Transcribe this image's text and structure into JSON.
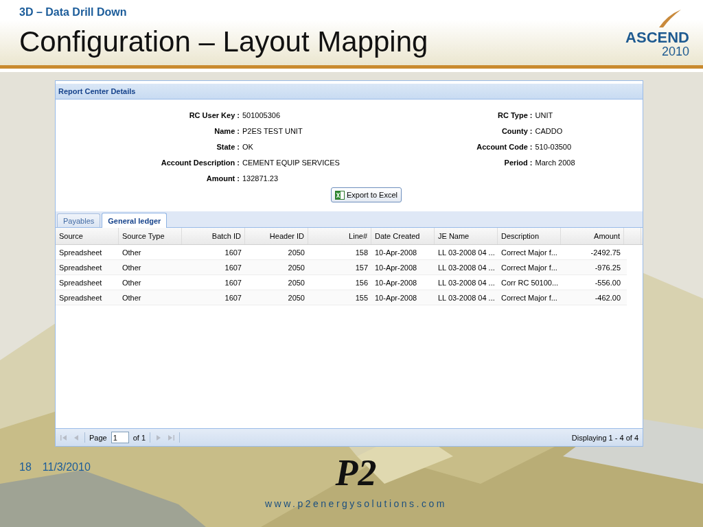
{
  "slide": {
    "section": "3D – Data Drill Down",
    "title": "Configuration – Layout Mapping",
    "logo": {
      "name": "ASCEND",
      "year": "2010"
    }
  },
  "panel": {
    "title": "Report Center Details",
    "fields_left": [
      {
        "label": "RC User Key :",
        "value": "501005306"
      },
      {
        "label": "Name :",
        "value": "P2ES TEST UNIT"
      },
      {
        "label": "State :",
        "value": "OK"
      },
      {
        "label": "Account Description :",
        "value": "CEMENT EQUIP SERVICES"
      },
      {
        "label": "Amount :",
        "value": "132871.23"
      }
    ],
    "fields_right": [
      {
        "label": "RC Type :",
        "value": "UNIT"
      },
      {
        "label": "County :",
        "value": "CADDO"
      },
      {
        "label": "Account Code :",
        "value": "510-03500"
      },
      {
        "label": "Period :",
        "value": "March 2008"
      }
    ],
    "export_button": "Export to Excel",
    "tabs": [
      {
        "label": "Payables",
        "selected": false
      },
      {
        "label": "General ledger",
        "selected": true
      }
    ],
    "table": {
      "columns": [
        {
          "label": "Source",
          "kind": "text"
        },
        {
          "label": "Source Type",
          "kind": "text"
        },
        {
          "label": "Batch ID",
          "kind": "number"
        },
        {
          "label": "Header ID",
          "kind": "number"
        },
        {
          "label": "Line#",
          "kind": "number"
        },
        {
          "label": "Date Created",
          "kind": "text"
        },
        {
          "label": "JE Name",
          "kind": "text"
        },
        {
          "label": "Description",
          "kind": "text"
        },
        {
          "label": "Amount",
          "kind": "number"
        }
      ],
      "rows": [
        [
          "Spreadsheet",
          "Other",
          "1607",
          "2050",
          "158",
          "10-Apr-2008",
          "LL 03-2008 04 ...",
          "Correct Major f...",
          "-2492.75"
        ],
        [
          "Spreadsheet",
          "Other",
          "1607",
          "2050",
          "157",
          "10-Apr-2008",
          "LL 03-2008 04 ...",
          "Correct Major f...",
          "-976.25"
        ],
        [
          "Spreadsheet",
          "Other",
          "1607",
          "2050",
          "156",
          "10-Apr-2008",
          "LL 03-2008 04 ...",
          "Corr RC 50100...",
          "-556.00"
        ],
        [
          "Spreadsheet",
          "Other",
          "1607",
          "2050",
          "155",
          "10-Apr-2008",
          "LL 03-2008 04 ...",
          "Correct Major f...",
          "-462.00"
        ]
      ]
    },
    "pager": {
      "page_label": "Page",
      "page_value": "1",
      "of_label": "of 1",
      "display": "Displaying 1 - 4 of 4"
    }
  },
  "footer": {
    "page_number": "18",
    "date": "11/3/2010",
    "logo": "P2",
    "website": "www.p2energysolutions.com"
  }
}
